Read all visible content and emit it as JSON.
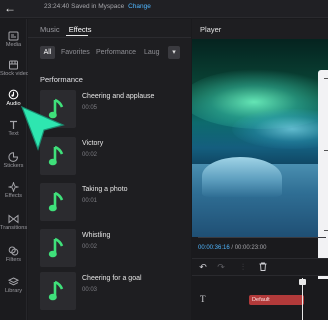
{
  "topbar": {
    "back_icon": "arrow-left-icon",
    "time": "23:24:40",
    "status": "Saved in Myspace",
    "link": "Change"
  },
  "sidebar": {
    "items": [
      {
        "label": "Media",
        "icon": "media-icon"
      },
      {
        "label": "Stock videos",
        "icon": "film-icon"
      },
      {
        "label": "Audio",
        "icon": "audio-icon"
      },
      {
        "label": "Text",
        "icon": "text-icon"
      },
      {
        "label": "Stickers",
        "icon": "sticker-icon"
      },
      {
        "label": "Effects",
        "icon": "sparkle-icon"
      },
      {
        "label": "Transitions",
        "icon": "transition-icon"
      },
      {
        "label": "Filters",
        "icon": "filter-icon"
      },
      {
        "label": "Library",
        "icon": "library-icon"
      }
    ],
    "active": "Audio"
  },
  "panel": {
    "tabs": [
      {
        "label": "Music"
      },
      {
        "label": "Effects"
      }
    ],
    "active_tab": "Effects",
    "filters": [
      "All",
      "Favorites",
      "Performance",
      "Laug"
    ],
    "section": "Performance",
    "tracks": [
      {
        "title": "Cheering and applause",
        "duration": "00:05"
      },
      {
        "title": "Victory",
        "duration": "00:02"
      },
      {
        "title": "Taking a photo",
        "duration": "00:01"
      },
      {
        "title": "Whistling",
        "duration": "00:02"
      },
      {
        "title": "Cheering for a goal",
        "duration": "00:03"
      }
    ]
  },
  "player": {
    "title": "Player",
    "current_time": "00:00:36:16",
    "separator": " / ",
    "total_time": "00:00:23:00"
  },
  "timeline": {
    "text_track_icon": "T",
    "clip_label": "Default"
  },
  "colors": {
    "accent": "#4fb6ff",
    "music_note": "#3fe07a",
    "cursor": "#2ee6b0",
    "clip": "#b23a3a"
  }
}
